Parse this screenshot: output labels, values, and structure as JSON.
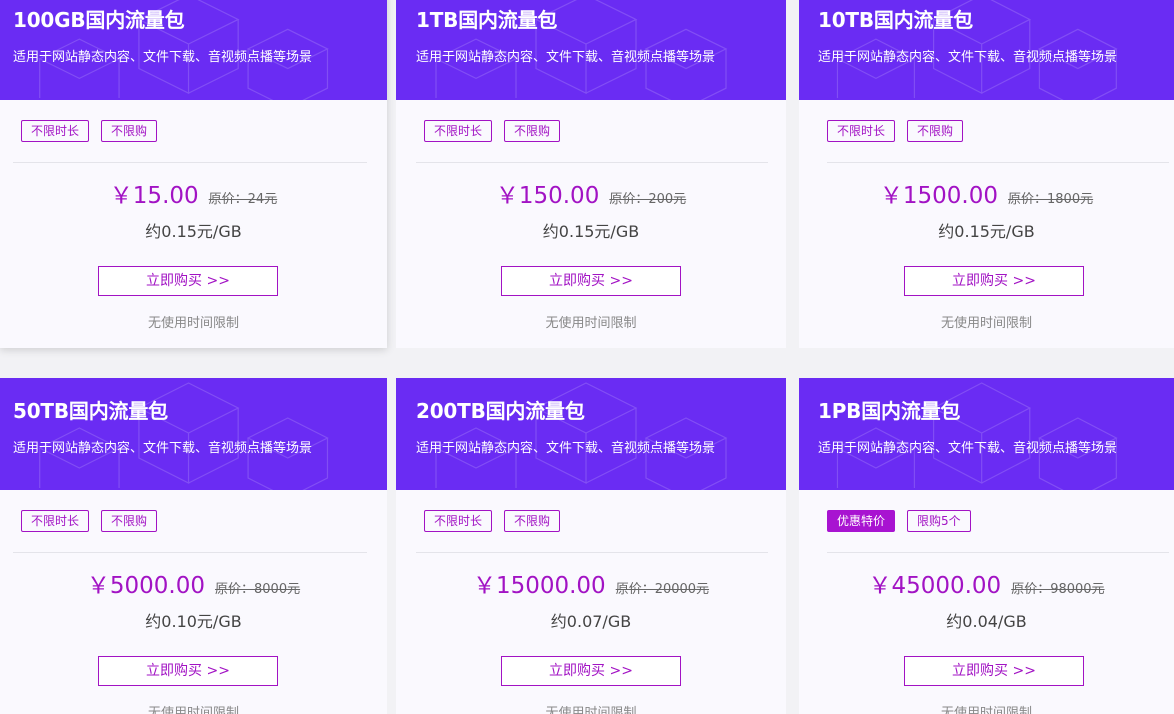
{
  "cards": [
    {
      "title": "100GB国内流量包",
      "desc": "适用于网站静态内容、文件下载、音视频点播等场景",
      "tag1": "不限时长",
      "tag2": "不限购",
      "price": "￥15.00",
      "orig": "原价：24元",
      "per_gb": "约0.15元/GB",
      "buy": "立即购买 >>",
      "note": "无使用时间限制"
    },
    {
      "title": "1TB国内流量包",
      "desc": "适用于网站静态内容、文件下载、音视频点播等场景",
      "tag1": "不限时长",
      "tag2": "不限购",
      "price": "￥150.00",
      "orig": "原价：200元",
      "per_gb": "约0.15元/GB",
      "buy": "立即购买 >>",
      "note": "无使用时间限制"
    },
    {
      "title": "10TB国内流量包",
      "desc": "适用于网站静态内容、文件下载、音视频点播等场景",
      "tag1": "不限时长",
      "tag2": "不限购",
      "price": "￥1500.00",
      "orig": "原价：1800元",
      "per_gb": "约0.15元/GB",
      "buy": "立即购买 >>",
      "note": "无使用时间限制"
    },
    {
      "title": "50TB国内流量包",
      "desc": "适用于网站静态内容、文件下载、音视频点播等场景",
      "tag1": "不限时长",
      "tag2": "不限购",
      "price": "￥5000.00",
      "orig": "原价：8000元",
      "per_gb": "约0.10元/GB",
      "buy": "立即购买 >>",
      "note": "无使用时间限制"
    },
    {
      "title": "200TB国内流量包",
      "desc": "适用于网站静态内容、文件下载、音视频点播等场景",
      "tag1": "不限时长",
      "tag2": "不限购",
      "price": "￥15000.00",
      "orig": "原价：20000元",
      "per_gb": "约0.07/GB",
      "buy": "立即购买 >>",
      "note": "无使用时间限制"
    },
    {
      "title": "1PB国内流量包",
      "desc": "适用于网站静态内容、文件下载、音视频点播等场景",
      "tag1": "优惠特价",
      "tag2": "限购5个",
      "price": "￥45000.00",
      "orig": "原价：98000元",
      "per_gb": "约0.04/GB",
      "buy": "立即购买 >>",
      "note": "无使用时间限制"
    }
  ],
  "colors": {
    "header_bg": "#6a2cf3",
    "accent": "#a213c4",
    "card_bg": "#faf9fe"
  }
}
